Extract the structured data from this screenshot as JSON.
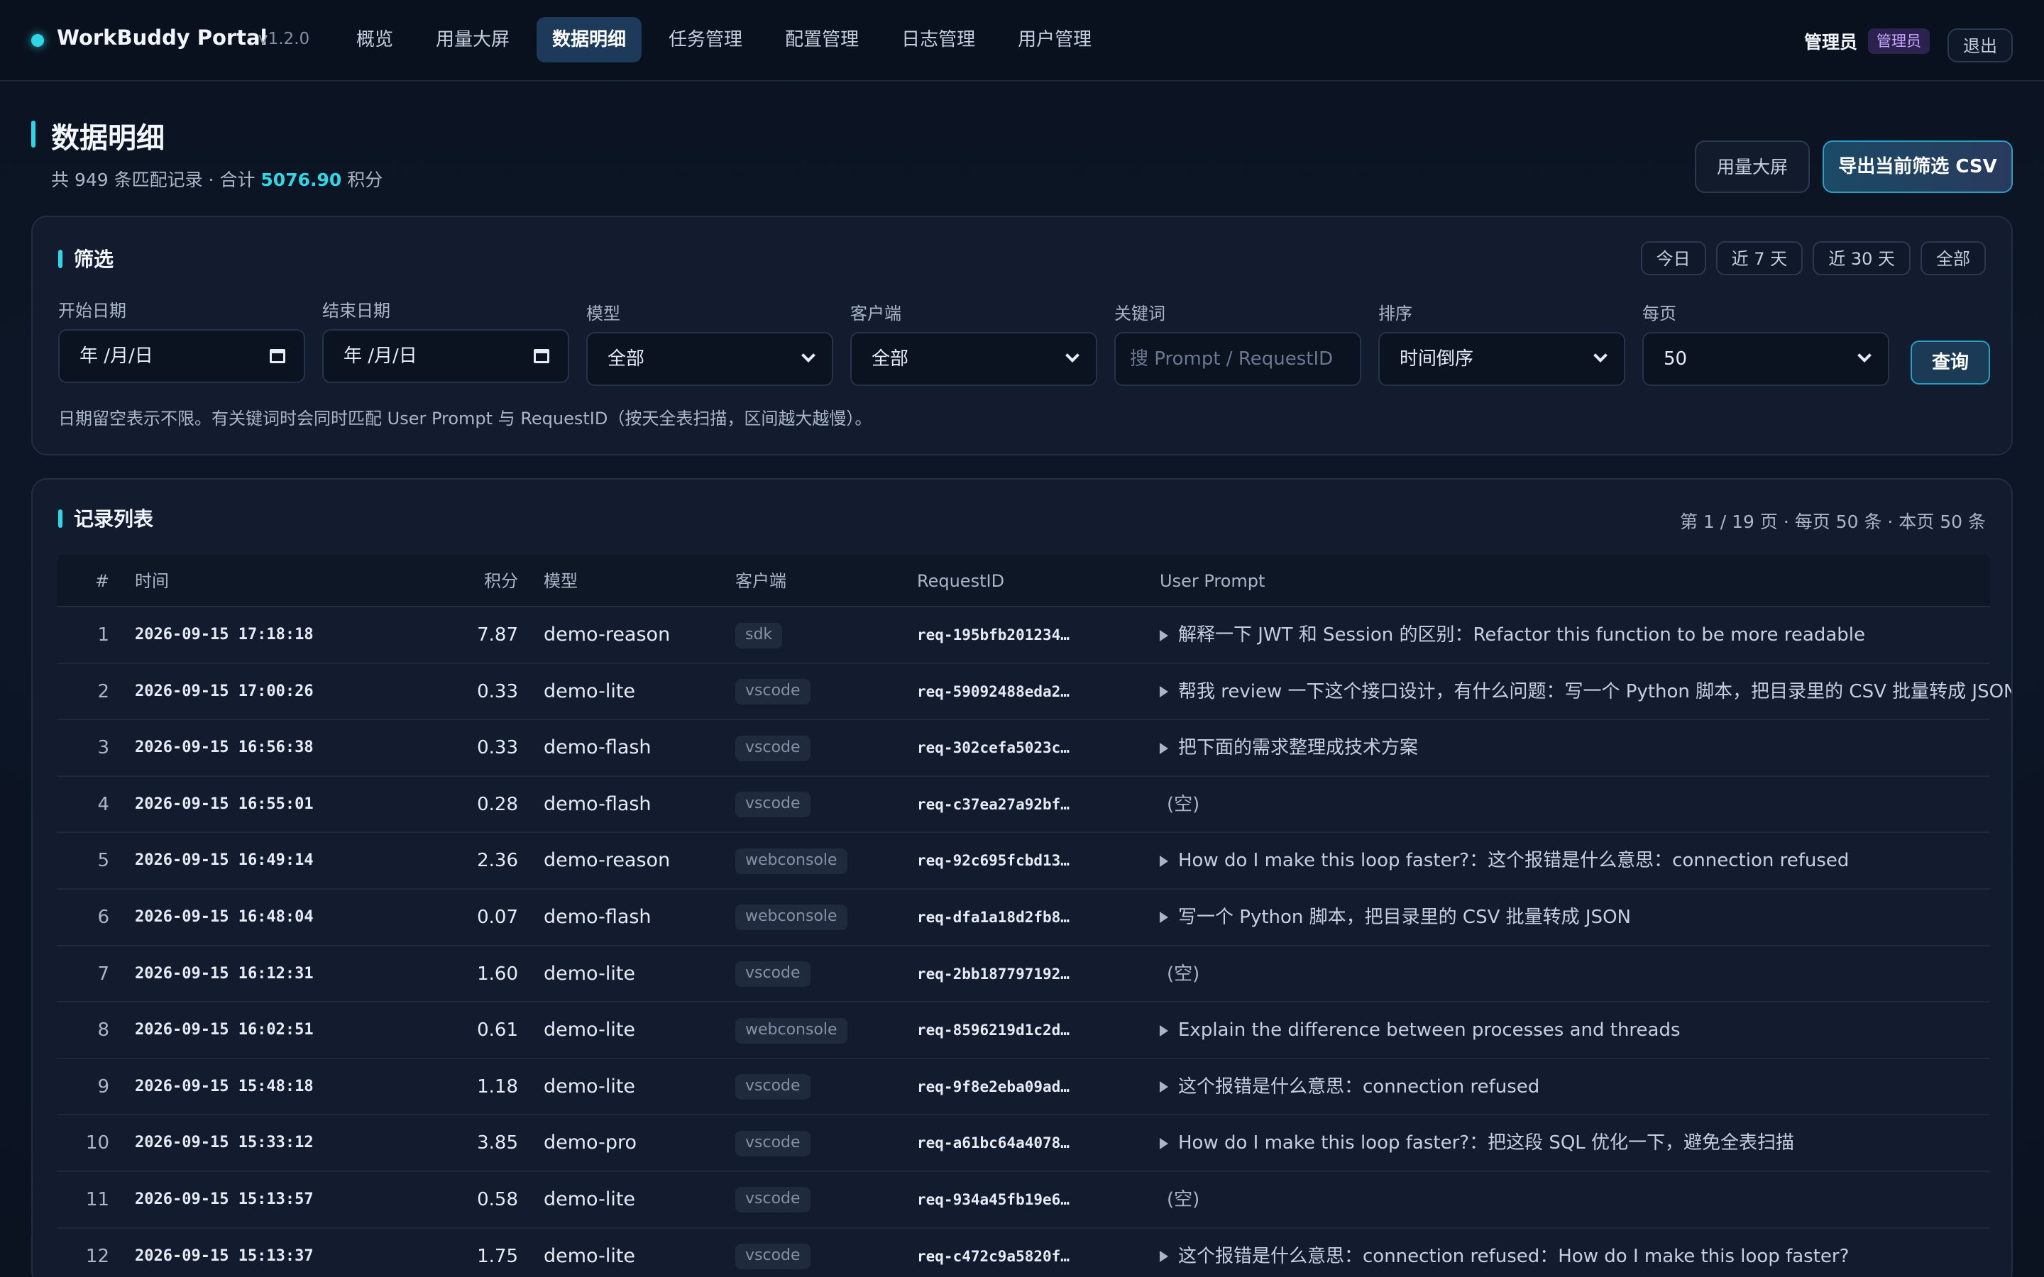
{
  "brand": {
    "name": "WorkBuddy Portal",
    "version": "v1.2.0"
  },
  "nav": [
    "概览",
    "用量大屏",
    "数据明细",
    "任务管理",
    "配置管理",
    "日志管理",
    "用户管理"
  ],
  "user": {
    "name": "管理员",
    "role": "管理员",
    "logout": "退出"
  },
  "page": {
    "title": "数据明细",
    "sub_prefix": "共 949 条匹配记录 · 合计",
    "sum": "5076.90",
    "sub_suffix": "积分",
    "btn_dash": "用量大屏",
    "btn_export": "导出当前筛选 CSV"
  },
  "filter": {
    "title": "筛选",
    "quick": [
      "今日",
      "近 7 天",
      "近 30 天",
      "全部"
    ],
    "start_label": "开始日期",
    "start_value": "年 /月/日",
    "end_label": "结束日期",
    "end_value": "年 /月/日",
    "model_label": "模型",
    "model_value": "全部",
    "client_label": "客户端",
    "client_value": "全部",
    "keyword_label": "关键词",
    "keyword_placeholder": "搜 Prompt / RequestID",
    "sort_label": "排序",
    "sort_value": "时间倒序",
    "per_page_label": "每页",
    "per_page_value": "50",
    "query": "查询",
    "hint": "日期留空表示不限。有关键词时会同时匹配 User Prompt 与 RequestID（按天全表扫描，区间越大越慢）。"
  },
  "records": {
    "title": "记录列表",
    "pager": "第 1 / 19 页 · 每页 50 条 · 本页 50 条",
    "columns": [
      "#",
      "时间",
      "积分",
      "模型",
      "客户端",
      "RequestID",
      "User Prompt"
    ],
    "rows": [
      {
        "idx": "1",
        "time": "2026-09-15 17:18:18",
        "pts": "7.87",
        "model": "demo-reason",
        "client": "sdk",
        "req": "req-195bfb201234…",
        "prompt": "解释一下 JWT 和 Session 的区别：Refactor this function to be more readable"
      },
      {
        "idx": "2",
        "time": "2026-09-15 17:00:26",
        "pts": "0.33",
        "model": "demo-lite",
        "client": "vscode",
        "req": "req-59092488eda2…",
        "prompt": "帮我 review 一下这个接口设计，有什么问题：写一个 Python 脚本，把目录里的 CSV 批量转成 JSON"
      },
      {
        "idx": "3",
        "time": "2026-09-15 16:56:38",
        "pts": "0.33",
        "model": "demo-flash",
        "client": "vscode",
        "req": "req-302cefa5023c…",
        "prompt": "把下面的需求整理成技术方案"
      },
      {
        "idx": "4",
        "time": "2026-09-15 16:55:01",
        "pts": "0.28",
        "model": "demo-flash",
        "client": "vscode",
        "req": "req-c37ea27a92bf…",
        "prompt": "(空)"
      },
      {
        "idx": "5",
        "time": "2026-09-15 16:49:14",
        "pts": "2.36",
        "model": "demo-reason",
        "client": "webconsole",
        "req": "req-92c695fcbd13…",
        "prompt": "How do I make this loop faster?：这个报错是什么意思：connection refused"
      },
      {
        "idx": "6",
        "time": "2026-09-15 16:48:04",
        "pts": "0.07",
        "model": "demo-flash",
        "client": "webconsole",
        "req": "req-dfa1a18d2fb8…",
        "prompt": "写一个 Python 脚本，把目录里的 CSV 批量转成 JSON"
      },
      {
        "idx": "7",
        "time": "2026-09-15 16:12:31",
        "pts": "1.60",
        "model": "demo-lite",
        "client": "vscode",
        "req": "req-2bb187797192…",
        "prompt": "(空)"
      },
      {
        "idx": "8",
        "time": "2026-09-15 16:02:51",
        "pts": "0.61",
        "model": "demo-lite",
        "client": "webconsole",
        "req": "req-8596219d1c2d…",
        "prompt": "Explain the difference between processes and threads"
      },
      {
        "idx": "9",
        "time": "2026-09-15 15:48:18",
        "pts": "1.18",
        "model": "demo-lite",
        "client": "vscode",
        "req": "req-9f8e2eba09ad…",
        "prompt": "这个报错是什么意思：connection refused"
      },
      {
        "idx": "10",
        "time": "2026-09-15 15:33:12",
        "pts": "3.85",
        "model": "demo-pro",
        "client": "vscode",
        "req": "req-a61bc64a4078…",
        "prompt": "How do I make this loop faster?：把这段 SQL 优化一下，避免全表扫描"
      },
      {
        "idx": "11",
        "time": "2026-09-15 15:13:57",
        "pts": "0.58",
        "model": "demo-lite",
        "client": "vscode",
        "req": "req-934a45fb19e6…",
        "prompt": "(空)"
      },
      {
        "idx": "12",
        "time": "2026-09-15 15:13:37",
        "pts": "1.75",
        "model": "demo-lite",
        "client": "vscode",
        "req": "req-c472c9a5820f…",
        "prompt": "这个报错是什么意思：connection refused：How do I make this loop faster?"
      }
    ]
  }
}
